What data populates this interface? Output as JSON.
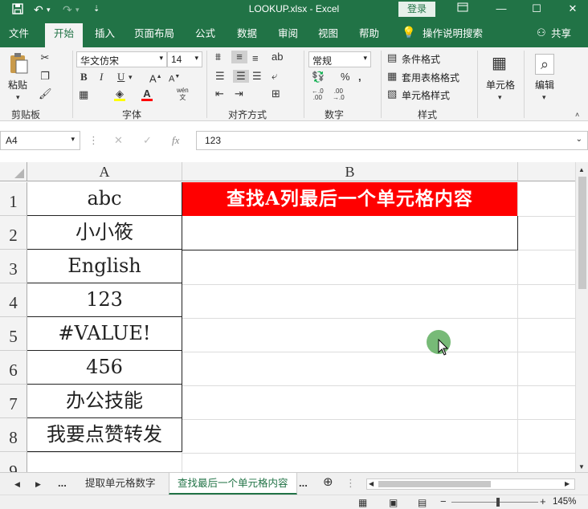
{
  "window": {
    "title": "LOOKUP.xlsx  -  Excel",
    "login": "登录"
  },
  "quick_access": {
    "save_icon": "save-icon",
    "undo_icon": "undo-icon",
    "redo_icon": "redo-icon",
    "customize_icon": "chevron-down-icon"
  },
  "window_controls": [
    "ribbon-display-icon",
    "minimize-icon",
    "restore-icon",
    "close-icon"
  ],
  "ribbon_tabs": [
    "文件",
    "开始",
    "插入",
    "页面布局",
    "公式",
    "数据",
    "审阅",
    "视图",
    "帮助"
  ],
  "tell_me": "操作说明搜索",
  "share": "共享",
  "ribbon": {
    "clipboard": {
      "paste": "粘贴",
      "label": "剪贴板"
    },
    "font": {
      "name": "华文仿宋",
      "size": "14",
      "bold": "B",
      "italic": "I",
      "underline": "U",
      "label": "字体",
      "wen": "wén"
    },
    "alignment": {
      "label": "对齐方式"
    },
    "number": {
      "format": "常规",
      "label": "数字"
    },
    "styles": {
      "conditional": "条件格式",
      "table": "套用表格格式",
      "cell_styles": "单元格样式",
      "label": "样式"
    },
    "cells": {
      "label": "单元格"
    },
    "editing": {
      "label": "编辑"
    }
  },
  "formula_bar": {
    "name_box": "A4",
    "formula": "123",
    "fx": "fx"
  },
  "columns": [
    "A",
    "B"
  ],
  "rows": [
    "1",
    "2",
    "3",
    "4",
    "5",
    "6",
    "7",
    "8",
    "9"
  ],
  "cells": {
    "A": [
      "abc",
      "小小筱",
      "English",
      "123",
      "#VALUE!",
      "456",
      "办公技能",
      "我要点赞转发"
    ],
    "B1": "查找A列最后一个单元格内容",
    "B1_fill": "#ff0000"
  },
  "sheet_tabs": [
    "提取单元格数字",
    "查找最后一个单元格内容"
  ],
  "sheet_nav_more": "...",
  "status": {
    "zoom": "145%"
  },
  "colors": {
    "accent": "#217346"
  }
}
